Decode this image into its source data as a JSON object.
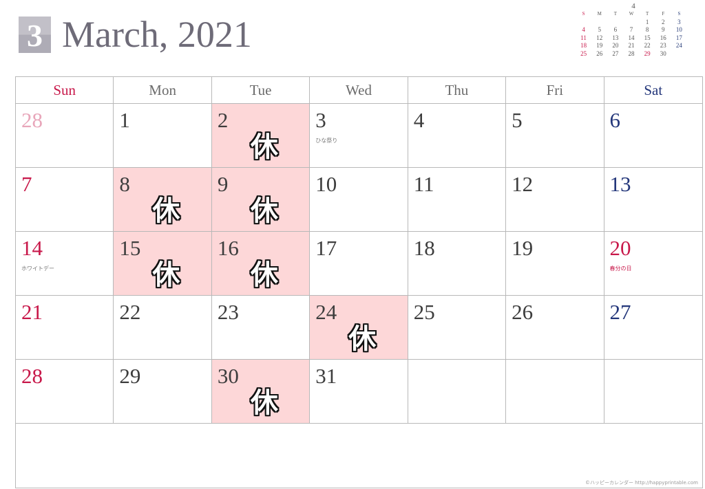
{
  "header": {
    "month_number": "3",
    "title": "March, 2021"
  },
  "mini_calendar": {
    "title": "4",
    "weekdays": [
      "S",
      "M",
      "T",
      "W",
      "T",
      "F",
      "S"
    ],
    "weeks": [
      [
        "",
        "",
        "",
        "",
        "1",
        "2",
        "3"
      ],
      [
        "4",
        "5",
        "6",
        "7",
        "8",
        "9",
        "10"
      ],
      [
        "11",
        "12",
        "13",
        "14",
        "15",
        "16",
        "17"
      ],
      [
        "18",
        "19",
        "20",
        "21",
        "22",
        "23",
        "24"
      ],
      [
        "25",
        "26",
        "27",
        "28",
        "29",
        "30",
        ""
      ]
    ],
    "holidays": [
      "29"
    ]
  },
  "weekdays": [
    "Sun",
    "Mon",
    "Tue",
    "Wed",
    "Thu",
    "Fri",
    "Sat"
  ],
  "colors": {
    "sunday": "#c8184a",
    "saturday": "#23367a",
    "day_off_bg": "#fdd7d8"
  },
  "day_off_mark": "休",
  "weeks": [
    [
      {
        "d": "28",
        "faded": true
      },
      {
        "d": "1"
      },
      {
        "d": "2",
        "off": true
      },
      {
        "d": "3",
        "note": "ひな祭り"
      },
      {
        "d": "4"
      },
      {
        "d": "5"
      },
      {
        "d": "6"
      }
    ],
    [
      {
        "d": "7"
      },
      {
        "d": "8",
        "off": true
      },
      {
        "d": "9",
        "off": true
      },
      {
        "d": "10"
      },
      {
        "d": "11"
      },
      {
        "d": "12"
      },
      {
        "d": "13"
      }
    ],
    [
      {
        "d": "14",
        "note": "ホワイトデー"
      },
      {
        "d": "15",
        "off": true
      },
      {
        "d": "16",
        "off": true
      },
      {
        "d": "17"
      },
      {
        "d": "18"
      },
      {
        "d": "19"
      },
      {
        "d": "20",
        "note": "春分の日",
        "holiday": true
      }
    ],
    [
      {
        "d": "21"
      },
      {
        "d": "22"
      },
      {
        "d": "23"
      },
      {
        "d": "24",
        "off": true
      },
      {
        "d": "25"
      },
      {
        "d": "26"
      },
      {
        "d": "27"
      }
    ],
    [
      {
        "d": "28"
      },
      {
        "d": "29"
      },
      {
        "d": "30",
        "off": true
      },
      {
        "d": "31"
      },
      {
        "d": ""
      },
      {
        "d": ""
      },
      {
        "d": ""
      }
    ]
  ],
  "credit": "©ハッピーカレンダー  http://happyprintable.com"
}
